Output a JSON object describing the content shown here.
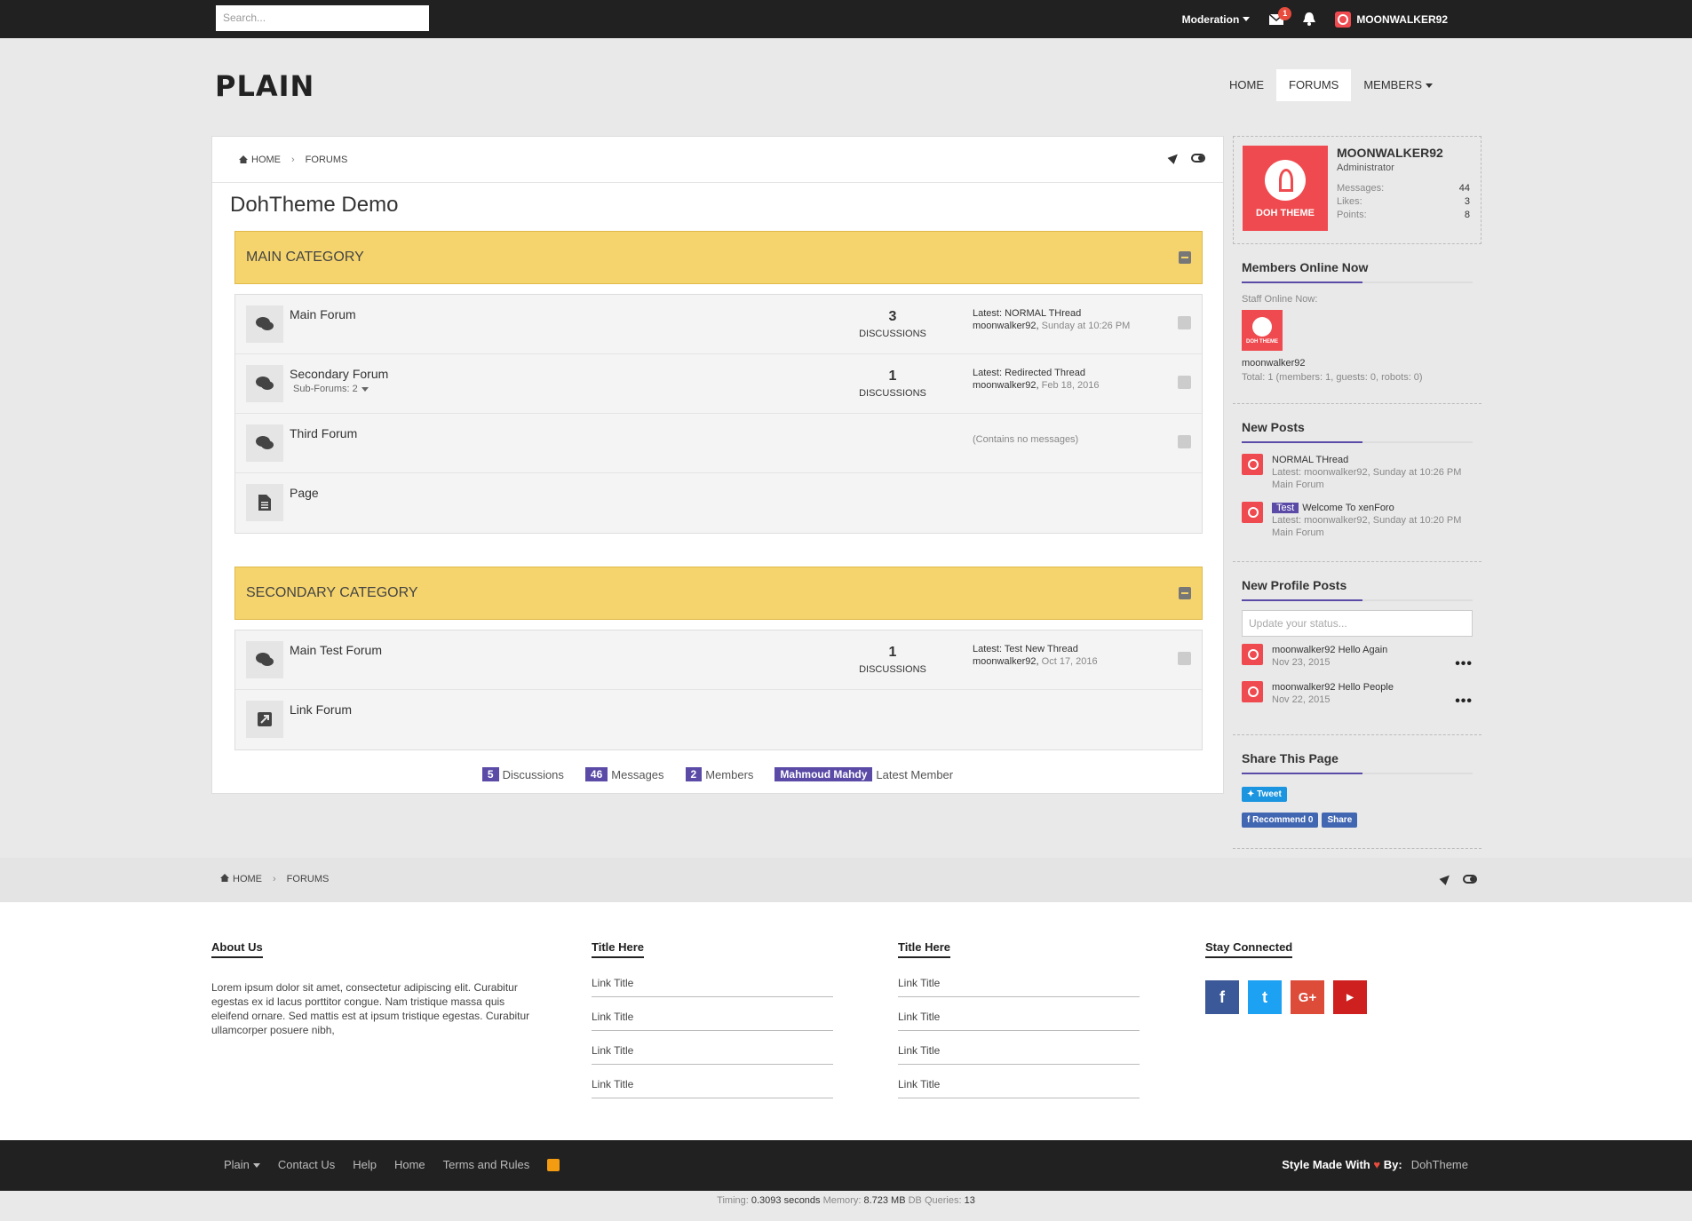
{
  "topbar": {
    "search_placeholder": "Search...",
    "moderation": "Moderation",
    "inbox_count": "1",
    "username": "MOONWALKER92"
  },
  "logo": "PLAIN",
  "nav": {
    "home": "HOME",
    "forums": "FORUMS",
    "members": "MEMBERS"
  },
  "breadcrumb": {
    "home": "HOME",
    "forums": "FORUMS"
  },
  "page_title": "DohTheme Demo",
  "categories": [
    {
      "title": "MAIN CATEGORY",
      "forums": [
        {
          "name": "Main Forum",
          "count": "3",
          "count_label": "DISCUSSIONS",
          "latest": "Latest: NORMAL THread",
          "user": "moonwalker92,",
          "date": "Sunday at 10:26 PM"
        },
        {
          "name": "Secondary Forum",
          "sub": "Sub-Forums: 2",
          "count": "1",
          "count_label": "DISCUSSIONS",
          "latest": "Latest: Redirected Thread",
          "user": "moonwalker92,",
          "date": "Feb 18, 2016"
        },
        {
          "name": "Third Forum",
          "empty": "(Contains no messages)"
        },
        {
          "name": "Page"
        }
      ]
    },
    {
      "title": "SECONDARY CATEGORY",
      "forums": [
        {
          "name": "Main Test Forum",
          "count": "1",
          "count_label": "DISCUSSIONS",
          "latest": "Latest: Test New Thread",
          "user": "moonwalker92,",
          "date": "Oct 17, 2016"
        },
        {
          "name": "Link Forum"
        }
      ]
    }
  ],
  "stats": {
    "discussions_n": "5",
    "discussions": "Discussions",
    "messages_n": "46",
    "messages": "Messages",
    "members_n": "2",
    "members": "Members",
    "latest_member": "Mahmoud Mahdy",
    "latest_label": "Latest Member"
  },
  "profile": {
    "logo_text": "DOH THEME",
    "name": "MOONWALKER92",
    "role": "Administrator",
    "messages_label": "Messages:",
    "messages": "44",
    "likes_label": "Likes:",
    "likes": "3",
    "points_label": "Points:",
    "points": "8"
  },
  "online": {
    "title": "Members Online Now",
    "staff": "Staff Online Now:",
    "avatar_text": "DOH THEME",
    "user": "moonwalker92",
    "total": "Total: 1 (members: 1, guests: 0, robots: 0)"
  },
  "new_posts": {
    "title": "New Posts",
    "items": [
      {
        "title": "NORMAL THread",
        "meta": "Latest: moonwalker92, Sunday at 10:26 PM",
        "forum": "Main Forum"
      },
      {
        "tag": "Test",
        "title": "Welcome To xenForo",
        "meta": "Latest: moonwalker92, Sunday at 10:20 PM",
        "forum": "Main Forum"
      }
    ]
  },
  "profile_posts": {
    "title": "New Profile Posts",
    "placeholder": "Update your status...",
    "items": [
      {
        "user": "moonwalker92",
        "text": "Hello Again",
        "date": "Nov 23, 2015"
      },
      {
        "user": "moonwalker92",
        "text": "Hello People",
        "date": "Nov 22, 2015"
      }
    ]
  },
  "share": {
    "title": "Share This Page",
    "tweet": "Tweet",
    "recommend": "Recommend 0",
    "share": "Share"
  },
  "footer": {
    "about_title": "About Us",
    "about_text": "Lorem ipsum dolor sit amet, consectetur adipiscing elit. Curabitur egestas ex id lacus porttitor congue. Nam tristique massa quis eleifend ornare. Sed mattis est at ipsum tristique egestas. Curabitur ullamcorper posuere nibh,",
    "col2_title": "Title Here",
    "col3_title": "Title Here",
    "link": "Link Title",
    "connect_title": "Stay Connected"
  },
  "bottom": {
    "plain": "Plain",
    "contact": "Contact Us",
    "help": "Help",
    "home": "Home",
    "terms": "Terms and Rules",
    "made": "Style Made With",
    "by": "By:",
    "brand": "DohTheme"
  },
  "timing": {
    "t_label": "Timing:",
    "t": "0.3093 seconds",
    "m_label": "Memory:",
    "m": "8.723 MB",
    "q_label": "DB Queries:",
    "q": "13"
  },
  "colors": {
    "accent": "#5b4ba7",
    "category": "#f5d46d",
    "brand_red": "#ef4a4f",
    "dark": "#212121"
  }
}
